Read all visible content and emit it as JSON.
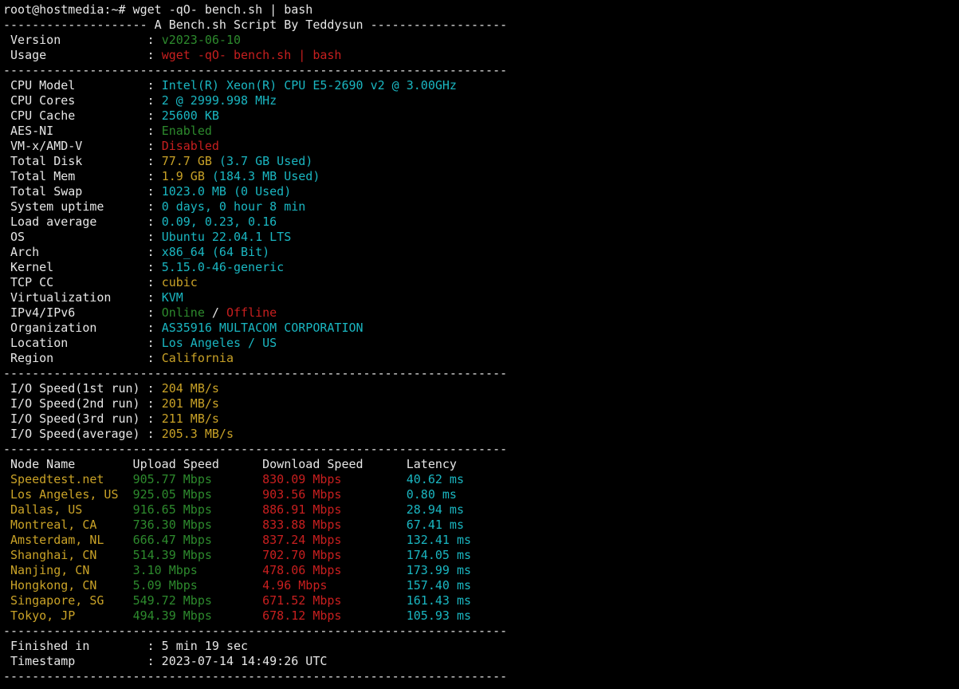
{
  "terminal": {
    "lines": [
      [
        [
          "root@hostmedia:~# wget -qO- bench.sh | bash",
          "white"
        ]
      ],
      [
        [
          "-------------------- A Bench.sh Script By Teddysun -------------------",
          "white"
        ]
      ],
      [
        [
          " Version            : ",
          "white"
        ],
        [
          "v2023-06-10",
          "green"
        ]
      ],
      [
        [
          " Usage              : ",
          "white"
        ],
        [
          "wget -qO- bench.sh | bash",
          "red"
        ]
      ],
      [
        [
          "----------------------------------------------------------------------",
          "white"
        ]
      ],
      [
        [
          " CPU Model          : ",
          "white"
        ],
        [
          "Intel(R) Xeon(R) CPU E5-2690 v2 @ 3.00GHz",
          "cyan"
        ]
      ],
      [
        [
          " CPU Cores          : ",
          "white"
        ],
        [
          "2 @ 2999.998 MHz",
          "cyan"
        ]
      ],
      [
        [
          " CPU Cache          : ",
          "white"
        ],
        [
          "25600 KB",
          "cyan"
        ]
      ],
      [
        [
          " AES-NI             : ",
          "white"
        ],
        [
          "Enabled",
          "green"
        ]
      ],
      [
        [
          " VM-x/AMD-V         : ",
          "white"
        ],
        [
          "Disabled",
          "red"
        ]
      ],
      [
        [
          " Total Disk         : ",
          "white"
        ],
        [
          "77.7 GB",
          "yellow"
        ],
        [
          " (3.7 GB Used)",
          "cyan"
        ]
      ],
      [
        [
          " Total Mem          : ",
          "white"
        ],
        [
          "1.9 GB",
          "yellow"
        ],
        [
          " (184.3 MB Used)",
          "cyan"
        ]
      ],
      [
        [
          " Total Swap         : ",
          "white"
        ],
        [
          "1023.0 MB",
          "cyan"
        ],
        [
          " (0 Used)",
          "cyan"
        ]
      ],
      [
        [
          " System uptime      : ",
          "white"
        ],
        [
          "0 days, 0 hour 8 min",
          "cyan"
        ]
      ],
      [
        [
          " Load average       : ",
          "white"
        ],
        [
          "0.09, 0.23, 0.16",
          "cyan"
        ]
      ],
      [
        [
          " OS                 : ",
          "white"
        ],
        [
          "Ubuntu 22.04.1 LTS",
          "cyan"
        ]
      ],
      [
        [
          " Arch               : ",
          "white"
        ],
        [
          "x86_64 (64 Bit)",
          "cyan"
        ]
      ],
      [
        [
          " Kernel             : ",
          "white"
        ],
        [
          "5.15.0-46-generic",
          "cyan"
        ]
      ],
      [
        [
          " TCP CC             : ",
          "white"
        ],
        [
          "cubic",
          "yellow"
        ]
      ],
      [
        [
          " Virtualization     : ",
          "white"
        ],
        [
          "KVM",
          "cyan"
        ]
      ],
      [
        [
          " IPv4/IPv6          : ",
          "white"
        ],
        [
          "Online",
          "green"
        ],
        [
          " / ",
          "white"
        ],
        [
          "Offline",
          "red"
        ]
      ],
      [
        [
          " Organization       : ",
          "white"
        ],
        [
          "AS35916 MULTACOM CORPORATION",
          "cyan"
        ]
      ],
      [
        [
          " Location           : ",
          "white"
        ],
        [
          "Los Angeles / US",
          "cyan"
        ]
      ],
      [
        [
          " Region             : ",
          "white"
        ],
        [
          "California",
          "yellow"
        ]
      ],
      [
        [
          "----------------------------------------------------------------------",
          "white"
        ]
      ],
      [
        [
          " I/O Speed(1st run) : ",
          "white"
        ],
        [
          "204 MB/s",
          "yellow"
        ]
      ],
      [
        [
          " I/O Speed(2nd run) : ",
          "white"
        ],
        [
          "201 MB/s",
          "yellow"
        ]
      ],
      [
        [
          " I/O Speed(3rd run) : ",
          "white"
        ],
        [
          "211 MB/s",
          "yellow"
        ]
      ],
      [
        [
          " I/O Speed(average) : ",
          "white"
        ],
        [
          "205.3 MB/s",
          "yellow"
        ]
      ],
      [
        [
          "----------------------------------------------------------------------",
          "white"
        ]
      ],
      [
        [
          " Node Name        Upload Speed      Download Speed      Latency     ",
          "white"
        ]
      ],
      [
        [
          " Speedtest.net    ",
          "yellow"
        ],
        [
          "905.77 Mbps       ",
          "green"
        ],
        [
          "830.09 Mbps         ",
          "red"
        ],
        [
          "40.62 ms    ",
          "cyan"
        ]
      ],
      [
        [
          " Los Angeles, US  ",
          "yellow"
        ],
        [
          "925.05 Mbps       ",
          "green"
        ],
        [
          "903.56 Mbps         ",
          "red"
        ],
        [
          "0.80 ms     ",
          "cyan"
        ]
      ],
      [
        [
          " Dallas, US       ",
          "yellow"
        ],
        [
          "916.65 Mbps       ",
          "green"
        ],
        [
          "886.91 Mbps         ",
          "red"
        ],
        [
          "28.94 ms    ",
          "cyan"
        ]
      ],
      [
        [
          " Montreal, CA     ",
          "yellow"
        ],
        [
          "736.30 Mbps       ",
          "green"
        ],
        [
          "833.88 Mbps         ",
          "red"
        ],
        [
          "67.41 ms    ",
          "cyan"
        ]
      ],
      [
        [
          " Amsterdam, NL    ",
          "yellow"
        ],
        [
          "666.47 Mbps       ",
          "green"
        ],
        [
          "837.24 Mbps         ",
          "red"
        ],
        [
          "132.41 ms   ",
          "cyan"
        ]
      ],
      [
        [
          " Shanghai, CN     ",
          "yellow"
        ],
        [
          "514.39 Mbps       ",
          "green"
        ],
        [
          "702.70 Mbps         ",
          "red"
        ],
        [
          "174.05 ms   ",
          "cyan"
        ]
      ],
      [
        [
          " Nanjing, CN      ",
          "yellow"
        ],
        [
          "3.10 Mbps         ",
          "green"
        ],
        [
          "478.06 Mbps         ",
          "red"
        ],
        [
          "173.99 ms   ",
          "cyan"
        ]
      ],
      [
        [
          " Hongkong, CN     ",
          "yellow"
        ],
        [
          "5.09 Mbps         ",
          "green"
        ],
        [
          "4.96 Mbps           ",
          "red"
        ],
        [
          "157.40 ms   ",
          "cyan"
        ]
      ],
      [
        [
          " Singapore, SG    ",
          "yellow"
        ],
        [
          "549.72 Mbps       ",
          "green"
        ],
        [
          "671.52 Mbps         ",
          "red"
        ],
        [
          "161.43 ms   ",
          "cyan"
        ]
      ],
      [
        [
          " Tokyo, JP        ",
          "yellow"
        ],
        [
          "494.39 Mbps       ",
          "green"
        ],
        [
          "678.12 Mbps         ",
          "red"
        ],
        [
          "105.93 ms   ",
          "cyan"
        ]
      ],
      [
        [
          "----------------------------------------------------------------------",
          "white"
        ]
      ],
      [
        [
          " Finished in        : 5 min 19 sec",
          "white"
        ]
      ],
      [
        [
          " Timestamp          : 2023-07-14 14:49:26 UTC",
          "white"
        ]
      ],
      [
        [
          "----------------------------------------------------------------------",
          "white"
        ]
      ]
    ]
  },
  "colors": {
    "background": "#000000",
    "white": "#e6e6e6",
    "green": "#2d8a2d",
    "red": "#c81f1f",
    "cyan": "#1ab6c1",
    "yellow": "#c9a227"
  }
}
